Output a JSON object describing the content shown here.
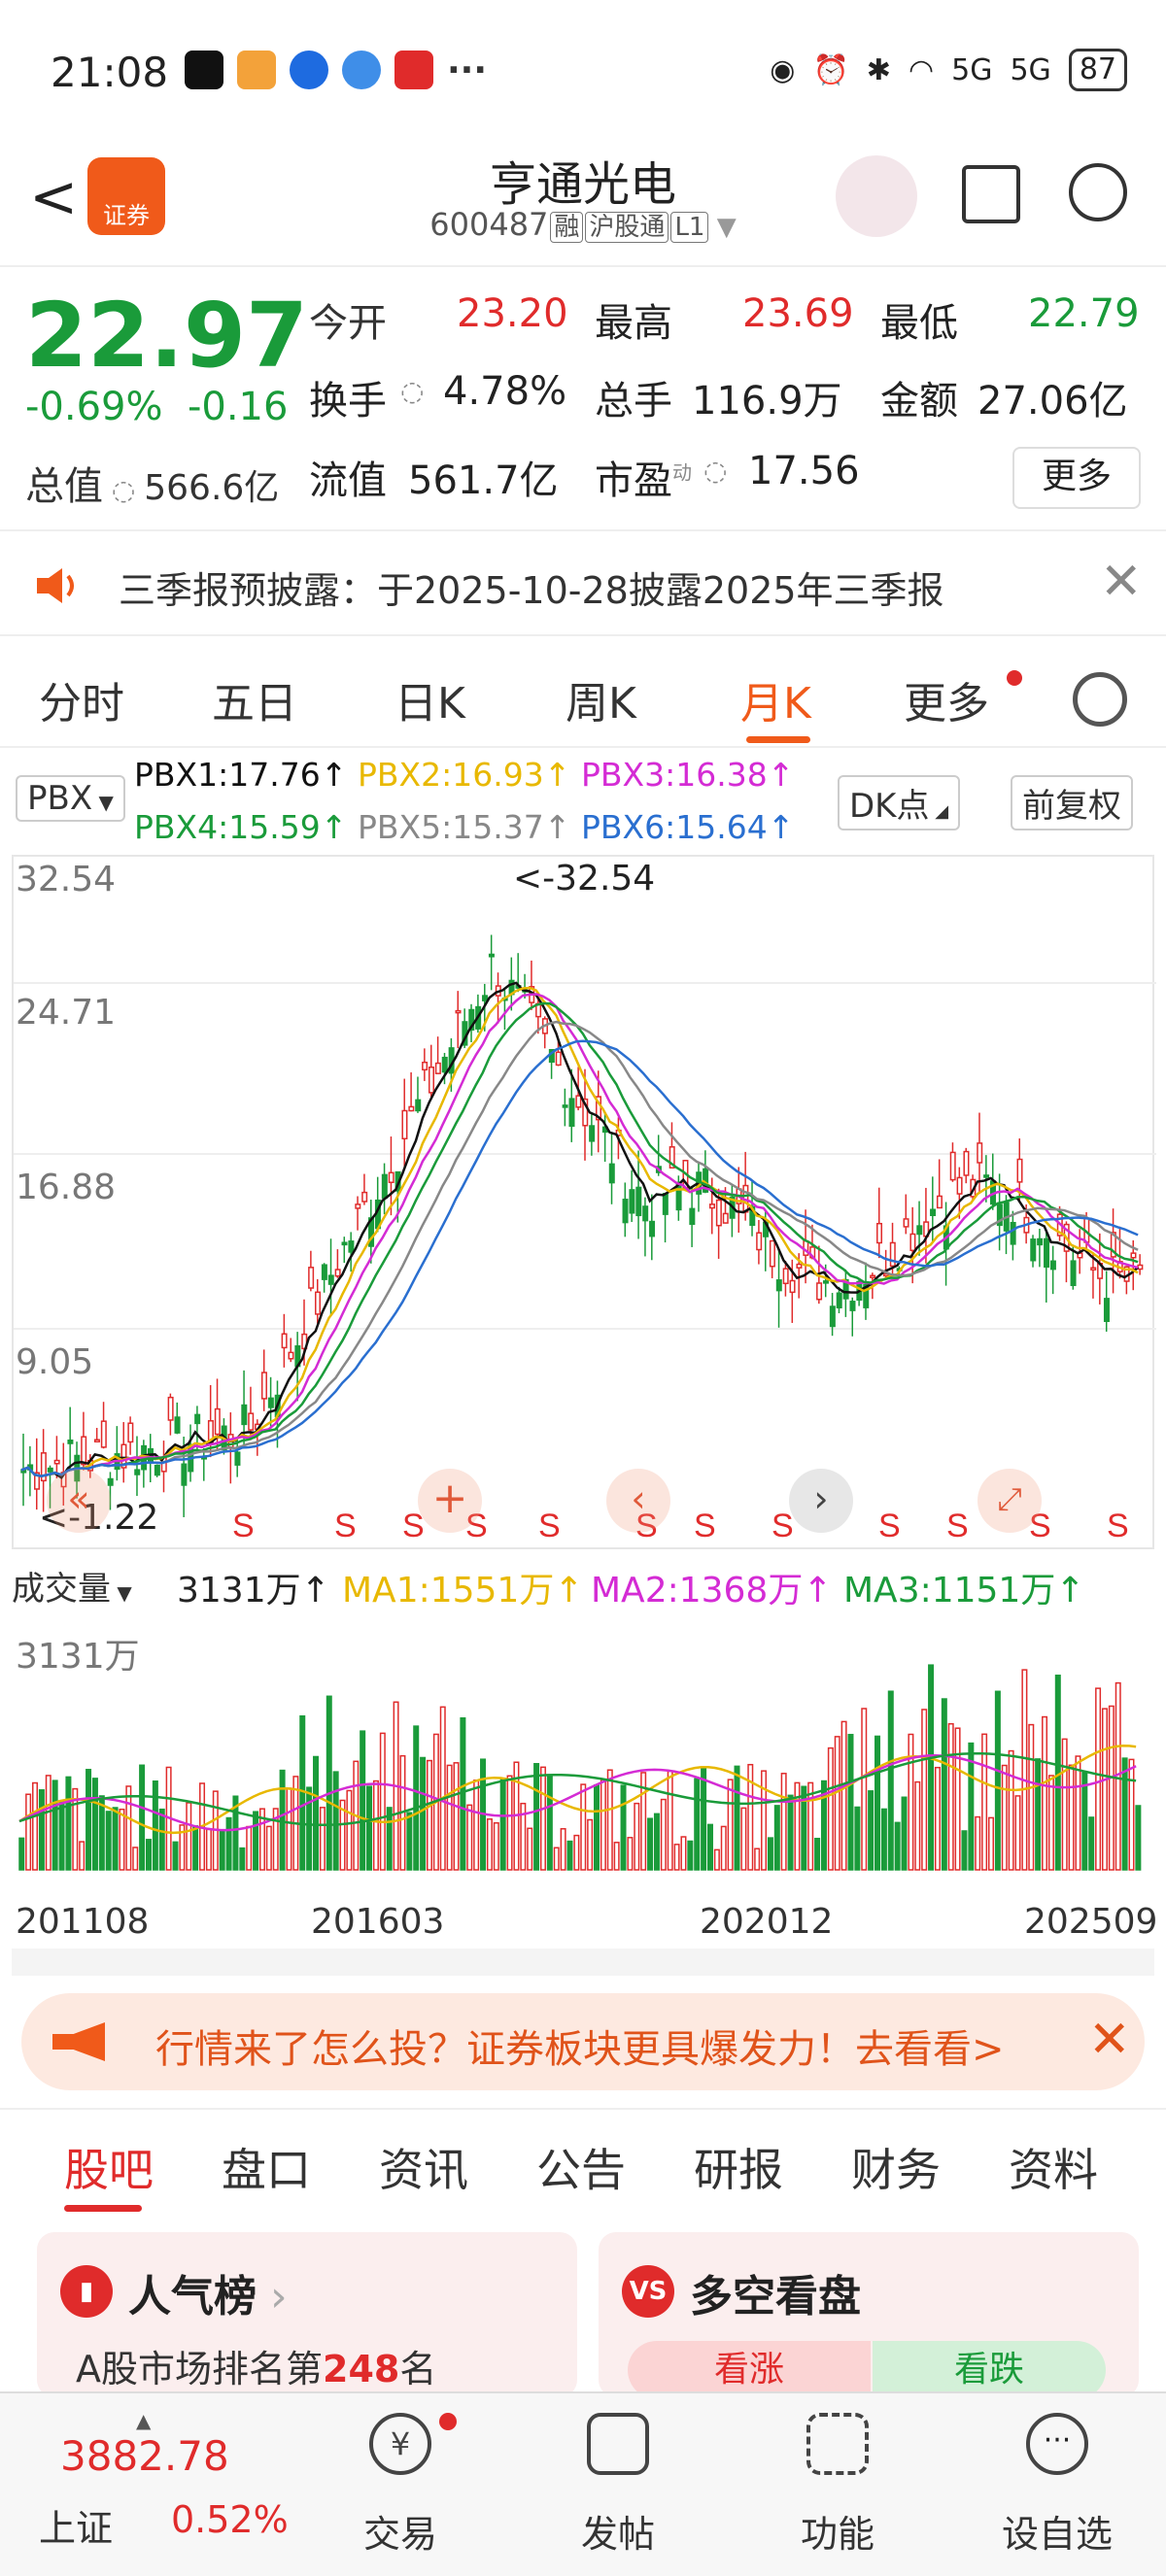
{
  "status": {
    "time": "21:08",
    "more": "···",
    "signal1": "5G",
    "signal2": "5G",
    "battery": "87"
  },
  "header": {
    "back": "<",
    "logo_text": "证券",
    "title": "亨通光电",
    "code": "600487",
    "tag1": "融",
    "tag2": "沪股通",
    "tag3": "L1"
  },
  "quote": {
    "price": "22.97",
    "pct": "-0.69%",
    "chg": "-0.16",
    "mv_label": "总值",
    "mv_value": "566.6亿",
    "open_label": "今开",
    "open": "23.20",
    "high_label": "最高",
    "high": "23.69",
    "low_label": "最低",
    "low": "22.79",
    "turn_label": "换手",
    "turn": "4.78%",
    "vol_label": "总手",
    "vol": "116.9万",
    "amt_label": "金额",
    "amt": "27.06亿",
    "float_label": "流值",
    "float": "561.7亿",
    "pe_label": "市盈",
    "pe_sup": "动",
    "pe": "17.56",
    "more": "更多"
  },
  "notice": {
    "text": "三季报预披露：于2025-10-28披露2025年三季报",
    "close": "✕"
  },
  "tabs": [
    "分时",
    "五日",
    "日K",
    "周K",
    "月K",
    "更多"
  ],
  "indicator": {
    "name": "PBX",
    "pbx1": "PBX1:17.76↑",
    "pbx2": "PBX2:16.93↑",
    "pbx3": "PBX3:16.38↑",
    "pbx4": "PBX4:15.59↑",
    "pbx5": "PBX5:15.37↑",
    "pbx6": "PBX6:15.64↑",
    "dk": "DK点",
    "adj": "前复权"
  },
  "chart_data": {
    "type": "candlestick",
    "y_ticks": [
      "32.54",
      "24.71",
      "16.88",
      "9.05"
    ],
    "max_label": "<-32.54",
    "min_label": "<-1.22",
    "signal_letter": "S",
    "x_labels": [
      "201108",
      "201603",
      "202012",
      "202509"
    ],
    "colors": {
      "up": "#e02b2b",
      "down": "#1a9b3a",
      "pbx1": "#111111",
      "pbx2": "#e8b800",
      "pbx3": "#d42bd4",
      "pbx4": "#1a9b3a",
      "pbx5": "#888888",
      "pbx6": "#2a6fd0"
    }
  },
  "volume": {
    "name": "成交量",
    "value": "3131万↑",
    "ma1": "MA1:1551万↑",
    "ma2": "MA2:1368万↑",
    "ma3": "MA3:1151万↑",
    "max_label": "3131万"
  },
  "banner": {
    "text": "行情来了怎么投？证券板块更具爆发力！去看看>",
    "close": "✕"
  },
  "subtabs": [
    "股吧",
    "盘口",
    "资讯",
    "公告",
    "研报",
    "财务",
    "资料"
  ],
  "cards": {
    "left": {
      "title": "人气榜",
      "desc_prefix": "A股市场排名第",
      "rank": "248",
      "desc_suffix": "名"
    },
    "right": {
      "title": "多空看盘",
      "bull": "看涨",
      "bear": "看跌"
    }
  },
  "bottomnav": {
    "index_value": "3882.78",
    "index_name": "上证",
    "index_pct": "0.52%",
    "items": [
      "交易",
      "发帖",
      "功能",
      "设自选"
    ]
  }
}
